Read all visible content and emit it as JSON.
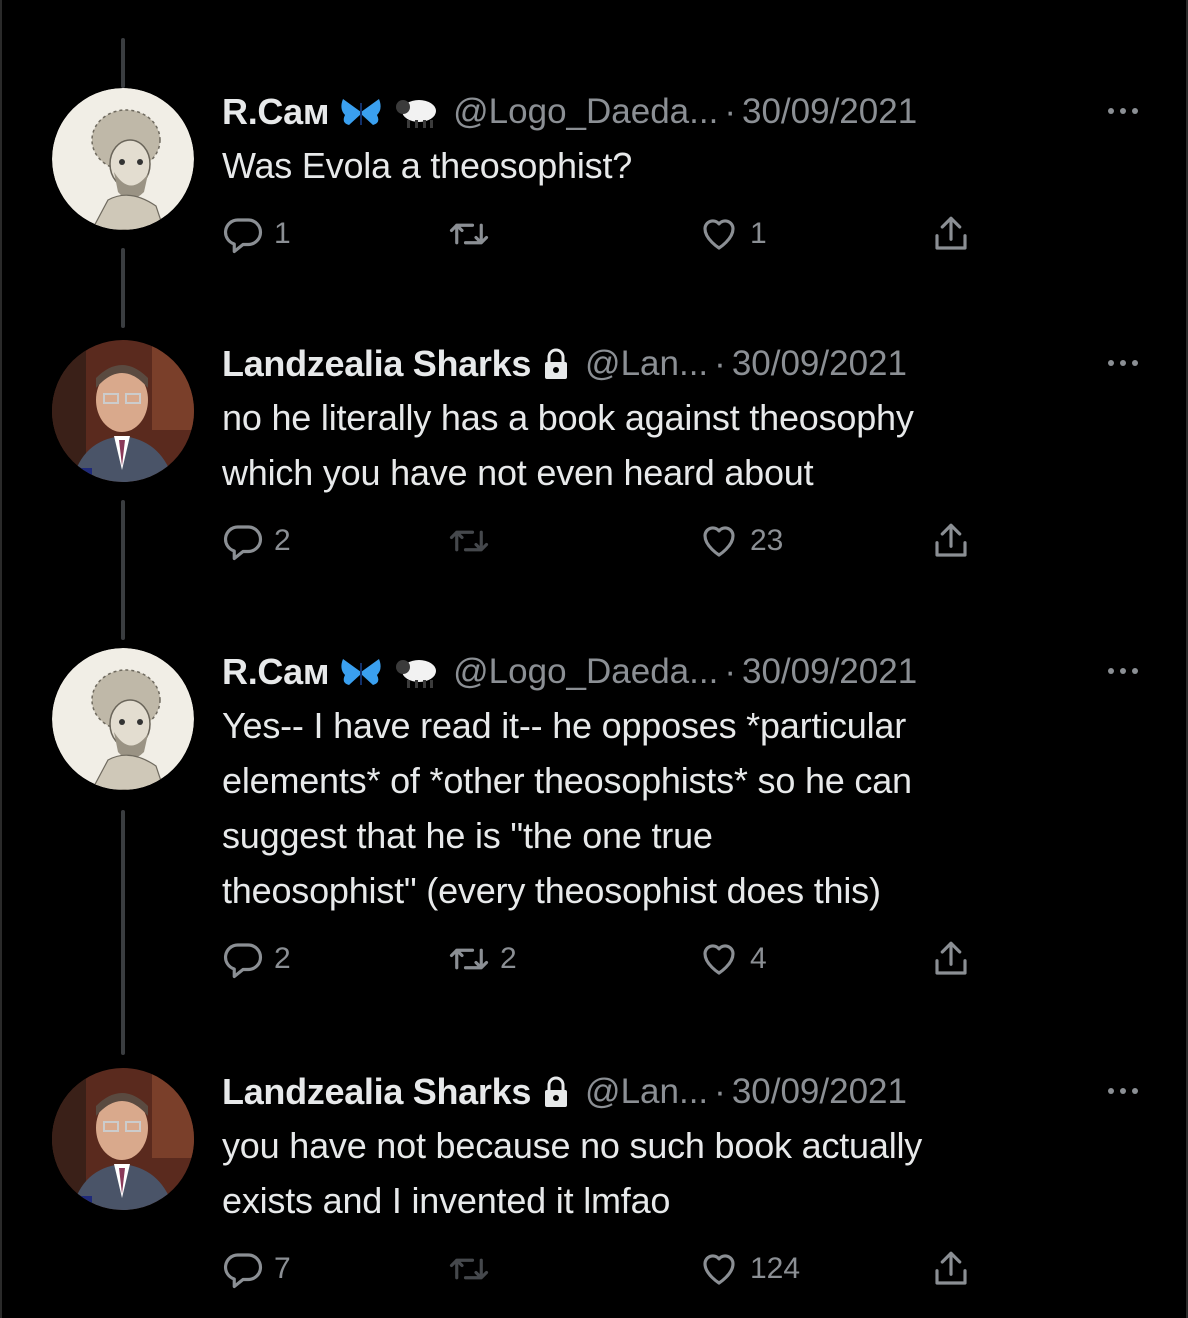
{
  "tweets": [
    {
      "name": "R.Cам",
      "handle": "@Logo_Daeda...",
      "separator": "·",
      "date": "30/09/2021",
      "text": "Was Evola a theosophist?",
      "reply_count": "1",
      "retweet_count": "",
      "like_count": "1",
      "badges": [
        "butterfly-emoji",
        "sheep-emoji"
      ],
      "avatar": "engraved-portrait"
    },
    {
      "name": "Landzealia Sharks",
      "handle": "@Lan...",
      "separator": "·",
      "date": "30/09/2021",
      "text": "no he literally has a book against theosophy\nwhich you have not even heard about",
      "reply_count": "2",
      "retweet_count": "",
      "like_count": "23",
      "badges": [
        "lock-icon"
      ],
      "avatar": "man-in-suit-photo"
    },
    {
      "name": "R.Cам",
      "handle": "@Logo_Daeda...",
      "separator": "·",
      "date": "30/09/2021",
      "text": "Yes-- I have read it-- he opposes *particular\nelements* of *other theosophists* so he can\nsuggest that he is \"the one true\ntheosophist\" (every theosophist does this)",
      "reply_count": "2",
      "retweet_count": "2",
      "like_count": "4",
      "badges": [
        "butterfly-emoji",
        "sheep-emoji"
      ],
      "avatar": "engraved-portrait"
    },
    {
      "name": "Landzealia Sharks",
      "handle": "@Lan...",
      "separator": "·",
      "date": "30/09/2021",
      "text": "you have not because no such book actually\nexists and I invented it lmfao",
      "reply_count": "7",
      "retweet_count": "",
      "like_count": "124",
      "badges": [
        "lock-icon"
      ],
      "avatar": "man-in-suit-photo"
    }
  ],
  "colors": {
    "background": "#000000",
    "text": "#e7e9ea",
    "secondary": "#8b8f94",
    "thread_line": "#3a3d40",
    "butterfly": "#3aa0f0"
  }
}
